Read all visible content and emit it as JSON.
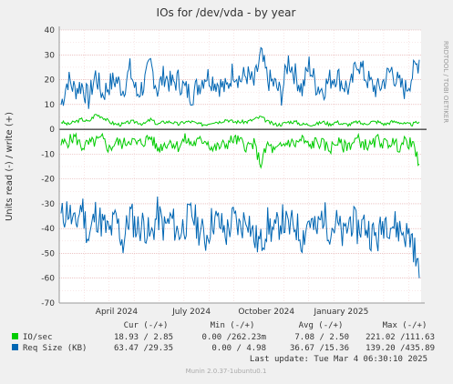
{
  "chart_data": {
    "type": "line",
    "title": "IOs for /dev/vda - by year",
    "ylabel": "Units read (-) / write (+)",
    "watermark": "RRDTOOL / TOBI OETIKER",
    "ylim": [
      -70,
      40
    ],
    "y_ticks": [
      40,
      30,
      20,
      10,
      0,
      -10,
      -20,
      -30,
      -40,
      -50,
      -60,
      -70
    ],
    "x_ticks": [
      "April 2024",
      "July 2024",
      "October 2024",
      "January 2025"
    ],
    "grid": true,
    "series": [
      {
        "name": "IO/sec",
        "color": "#00cc00",
        "write_values": [
          3,
          2,
          3,
          4,
          3,
          6,
          5,
          3,
          2,
          2,
          3,
          3,
          2,
          4,
          2,
          3,
          3,
          2,
          3,
          3,
          2,
          2,
          3,
          3,
          4,
          3,
          3,
          3,
          4,
          5,
          3,
          2,
          2,
          3,
          3,
          2,
          2,
          2,
          3,
          2,
          3,
          2,
          2,
          3,
          2,
          3,
          3,
          2,
          3,
          3,
          2,
          2,
          3
        ],
        "read_values": [
          -6,
          -5,
          -3,
          -7,
          -6,
          -5,
          -4,
          -8,
          -5,
          -6,
          -4,
          -6,
          -5,
          -3,
          -8,
          -6,
          -5,
          -7,
          -4,
          -6,
          -5,
          -4,
          -8,
          -7,
          -6,
          -4,
          -5,
          -7,
          -6,
          -14,
          -6,
          -9,
          -7,
          -5,
          -6,
          -4,
          -7,
          -5,
          -6,
          -8,
          -5,
          -7,
          -6,
          -4,
          -6,
          -7,
          -4,
          -6,
          -5,
          -7,
          -5,
          -6,
          -14
        ]
      },
      {
        "name": "Req Size (KB)",
        "color": "#0066b3",
        "write_values": [
          10,
          20,
          16,
          18,
          12,
          22,
          14,
          18,
          20,
          16,
          24,
          14,
          18,
          26,
          16,
          22,
          18,
          20,
          16,
          14,
          18,
          22,
          20,
          18,
          16,
          24,
          20,
          22,
          18,
          30,
          20,
          18,
          14,
          28,
          22,
          16,
          26,
          18,
          16,
          20,
          22,
          18,
          16,
          28,
          22,
          18,
          16,
          20,
          24,
          18,
          16,
          22,
          28
        ],
        "read_values": [
          -36,
          -32,
          -40,
          -30,
          -44,
          -34,
          -38,
          -42,
          -36,
          -46,
          -34,
          -40,
          -38,
          -44,
          -34,
          -40,
          -36,
          -42,
          -38,
          -34,
          -40,
          -44,
          -36,
          -38,
          -42,
          -36,
          -40,
          -34,
          -44,
          -46,
          -38,
          -42,
          -36,
          -40,
          -38,
          -44,
          -36,
          -42,
          -34,
          -40,
          -38,
          -44,
          -36,
          -40,
          -38,
          -42,
          -44,
          -36,
          -38,
          -40,
          -42,
          -44,
          -60
        ]
      }
    ],
    "legend": {
      "headers": [
        "Cur (-/+)",
        "Min (-/+)",
        "Avg (-/+)",
        "Max (-/+)"
      ],
      "rows": [
        {
          "label": "IO/sec",
          "color": "#00cc00",
          "cur": "18.93 / 2.85",
          "min": "0.00 /262.23m",
          "avg": "7.08 / 2.50",
          "max": "221.02 /111.63"
        },
        {
          "label": "Req Size (KB)",
          "color": "#0066b3",
          "cur": "63.47 /29.35",
          "min": "0.00 / 4.98",
          "avg": "36.67 /15.36",
          "max": "139.20 /435.89"
        }
      ],
      "last_update": "Last update: Tue Mar  4 06:30:10 2025"
    },
    "footer": "Munin 2.0.37-1ubuntu0.1"
  }
}
